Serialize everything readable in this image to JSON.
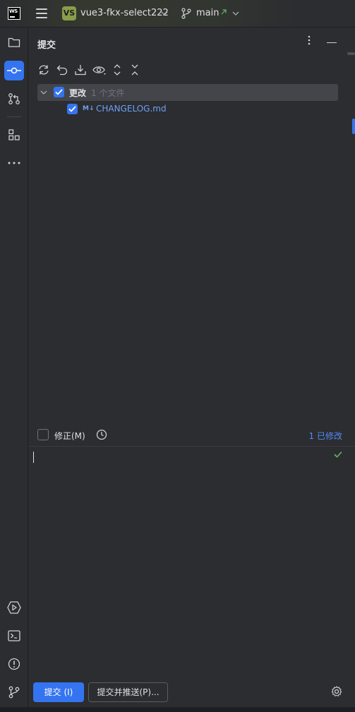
{
  "titlebar": {
    "logo_text": "WS",
    "project_badge": "VS",
    "project_name": "vue3-fkx-select222",
    "branch": "main",
    "icons": [
      "hamburger-menu-icon",
      "chevron-down-icon",
      "branch-icon",
      "outgoing-arrow-icon"
    ]
  },
  "sidebar": {
    "items": [
      {
        "name": "project-icon",
        "active": false
      },
      {
        "name": "commit-icon",
        "active": true
      },
      {
        "name": "pull-requests-icon",
        "active": false
      },
      {
        "name": "structure-icon",
        "active": false
      },
      {
        "name": "more-icon",
        "active": false
      }
    ],
    "bottom_items": [
      "run-icon",
      "terminal-icon",
      "problems-icon",
      "git-icon"
    ]
  },
  "panel": {
    "title": "提交",
    "toolbar_icons": [
      "refresh-icon",
      "rollback-icon",
      "update-icon",
      "view-icon",
      "expand-all-icon",
      "collapse-all-icon"
    ]
  },
  "changes": {
    "group_label": "更改",
    "group_count": "1 个文件",
    "files": [
      {
        "icon": "M↓",
        "name": "CHANGELOG.md",
        "checked": true
      }
    ]
  },
  "amend": {
    "label": "修正(M)",
    "checked": false,
    "modified_text": "1 已修改"
  },
  "message": {
    "value": ""
  },
  "actions": {
    "commit_label": "提交 (I)",
    "commit_push_label": "提交并推送(P)..."
  },
  "colors": {
    "accent": "#3574f0",
    "background": "#2b2d30",
    "link": "#548af7",
    "success": "#5fb865"
  }
}
